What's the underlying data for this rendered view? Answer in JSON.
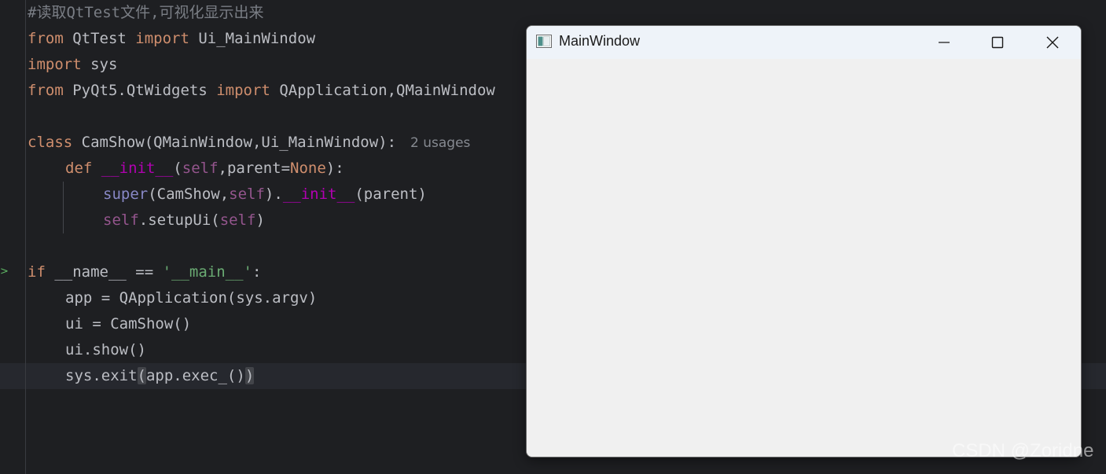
{
  "editor": {
    "lines": {
      "l1_comment": "#读取QtTest文件,可视化显示出来",
      "l2_from": "from",
      "l2_module": " QtTest ",
      "l2_import": "import",
      "l2_name": " Ui_MainWindow",
      "l3_import": "import",
      "l3_name": " sys",
      "l4_from": "from",
      "l4_module": " PyQt5.QtWidgets ",
      "l4_import": "import",
      "l4_names": " QApplication,QMainWindow",
      "l6_class": "class",
      "l6_name": " CamShow",
      "l6_rest": "(QMainWindow,Ui_MainWindow):",
      "l6_hint": "2 usages",
      "l7_def": "def",
      "l7_init": "__init__",
      "l7_open": "(",
      "l7_self": "self",
      "l7_param": ",parent=",
      "l7_none": "None",
      "l7_close": "):",
      "l8_super": "super",
      "l8_a": "(CamShow,",
      "l8_self": "self",
      "l8_b": ").",
      "l8_init": "__init__",
      "l8_c": "(parent)",
      "l9_self": "self",
      "l9_a": ".setupUi(",
      "l9_self2": "self",
      "l9_b": ")",
      "l11_if": "if",
      "l11_a": " __name__ == ",
      "l11_str": "'__main__'",
      "l11_b": ":",
      "l12": "app = QApplication(sys.argv)",
      "l13": "ui = CamShow()",
      "l14": "ui.show()",
      "l15_a": "sys.exit",
      "l15_open": "(",
      "l15_b": "app.exec_()",
      "l15_close": ")"
    },
    "run_marker": ">"
  },
  "qt_window": {
    "title": "MainWindow",
    "controls": [
      "minimize",
      "maximize",
      "close"
    ]
  },
  "watermark": "CSDN @Zoridne",
  "colors": {
    "editor_bg": "#1e1f22",
    "keyword": "#cf8e6d",
    "comment": "#7a7e85",
    "magic": "#b200b2",
    "self": "#94558d",
    "string": "#6aab73",
    "window_bg": "#f0f0f0"
  }
}
